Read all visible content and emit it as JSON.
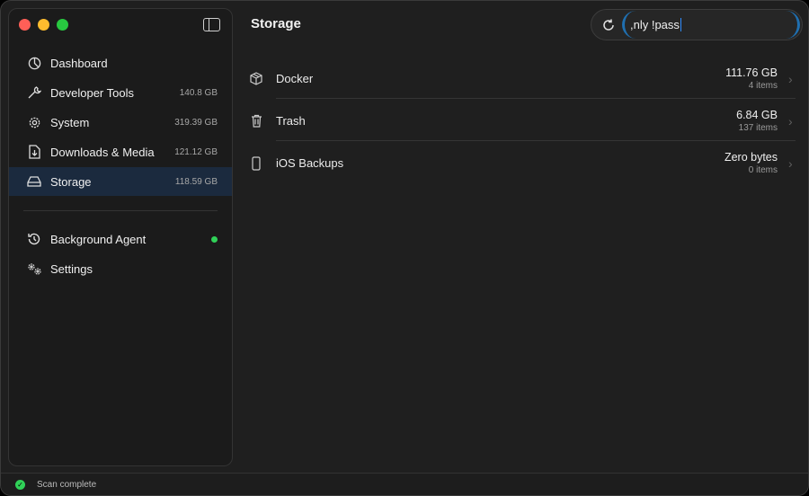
{
  "sidebar": {
    "items": [
      {
        "label": "Dashboard",
        "size": ""
      },
      {
        "label": "Developer Tools",
        "size": "140.8 GB"
      },
      {
        "label": "System",
        "size": "319.39 GB"
      },
      {
        "label": "Downloads & Media",
        "size": "121.12 GB"
      },
      {
        "label": "Storage",
        "size": "118.59 GB"
      }
    ],
    "bottom": [
      {
        "label": "Background Agent"
      },
      {
        "label": "Settings"
      }
    ]
  },
  "header": {
    "title": "Storage",
    "search_value": ",nly !pass"
  },
  "rows": [
    {
      "name": "Docker",
      "size": "111.76 GB",
      "count": "4 items"
    },
    {
      "name": "Trash",
      "size": "6.84 GB",
      "count": "137 items"
    },
    {
      "name": "iOS Backups",
      "size": "Zero bytes",
      "count": "0 items"
    }
  ],
  "status": {
    "text": "Scan complete"
  },
  "colors": {
    "accent": "#1f6fb0",
    "active_bg": "#1b2a3e",
    "green": "#30d158"
  }
}
